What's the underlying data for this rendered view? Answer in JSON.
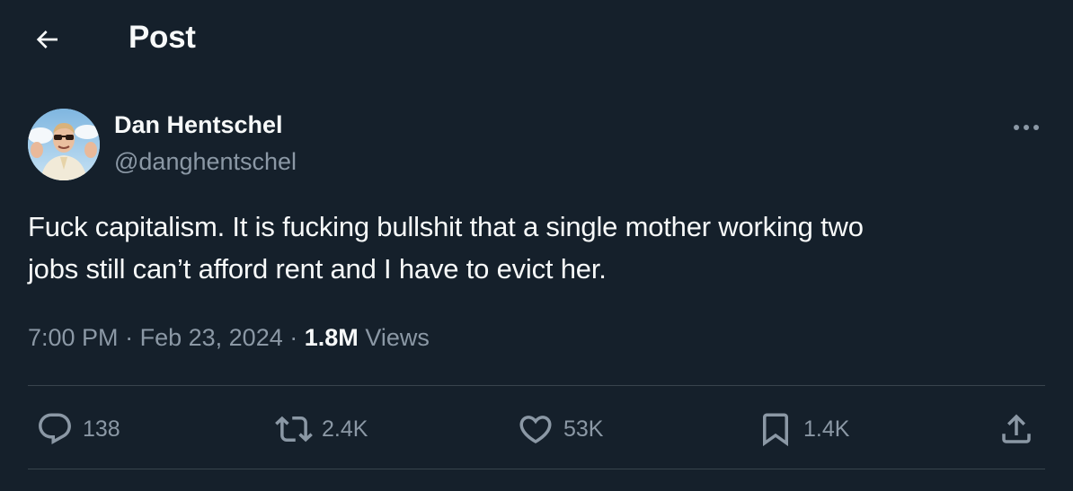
{
  "header": {
    "title": "Post",
    "back_icon": "arrow-left-icon"
  },
  "author": {
    "display_name": "Dan Hentschel",
    "handle": "@danghentschel",
    "more_icon": "more-horizontal-icon"
  },
  "tweet": {
    "text_line1": "Fuck capitalism. It is fucking bullshit that a single mother working two",
    "text_line2": "jobs still can’t afford rent and I have to evict her.",
    "time": "7:00 PM",
    "separator": "·",
    "date": "Feb 23, 2024",
    "views_count": "1.8M",
    "views_label": "Views"
  },
  "actions": {
    "replies": "138",
    "reposts": "2.4K",
    "likes": "53K",
    "bookmarks": "1.4K"
  },
  "colors": {
    "background": "#15202b",
    "text": "#f7f9f9",
    "secondary": "#8b98a5",
    "divider": "#38444d"
  }
}
